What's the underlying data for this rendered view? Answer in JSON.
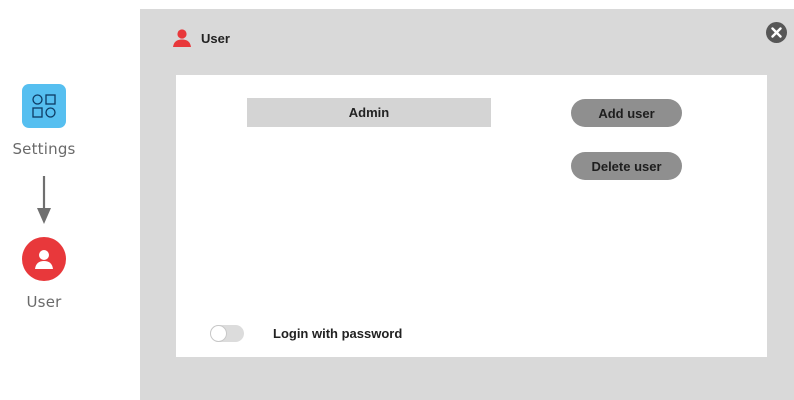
{
  "navigation": {
    "settings": {
      "label": "Settings",
      "icon": "settings-grid-icon",
      "color": "#56bff0"
    },
    "user": {
      "label": "User",
      "icon": "user-icon",
      "color": "#e8383b"
    },
    "flow_icon": "arrow-down-icon"
  },
  "dialog": {
    "title": "User",
    "title_icon": "user-icon",
    "accent_color": "#e8383b",
    "close_icon": "close-icon",
    "users": [
      {
        "name": "Admin"
      }
    ],
    "buttons": {
      "add_user": "Add user",
      "delete_user": "Delete user"
    },
    "login_with_password": {
      "label": "Login with password",
      "enabled": false
    }
  }
}
